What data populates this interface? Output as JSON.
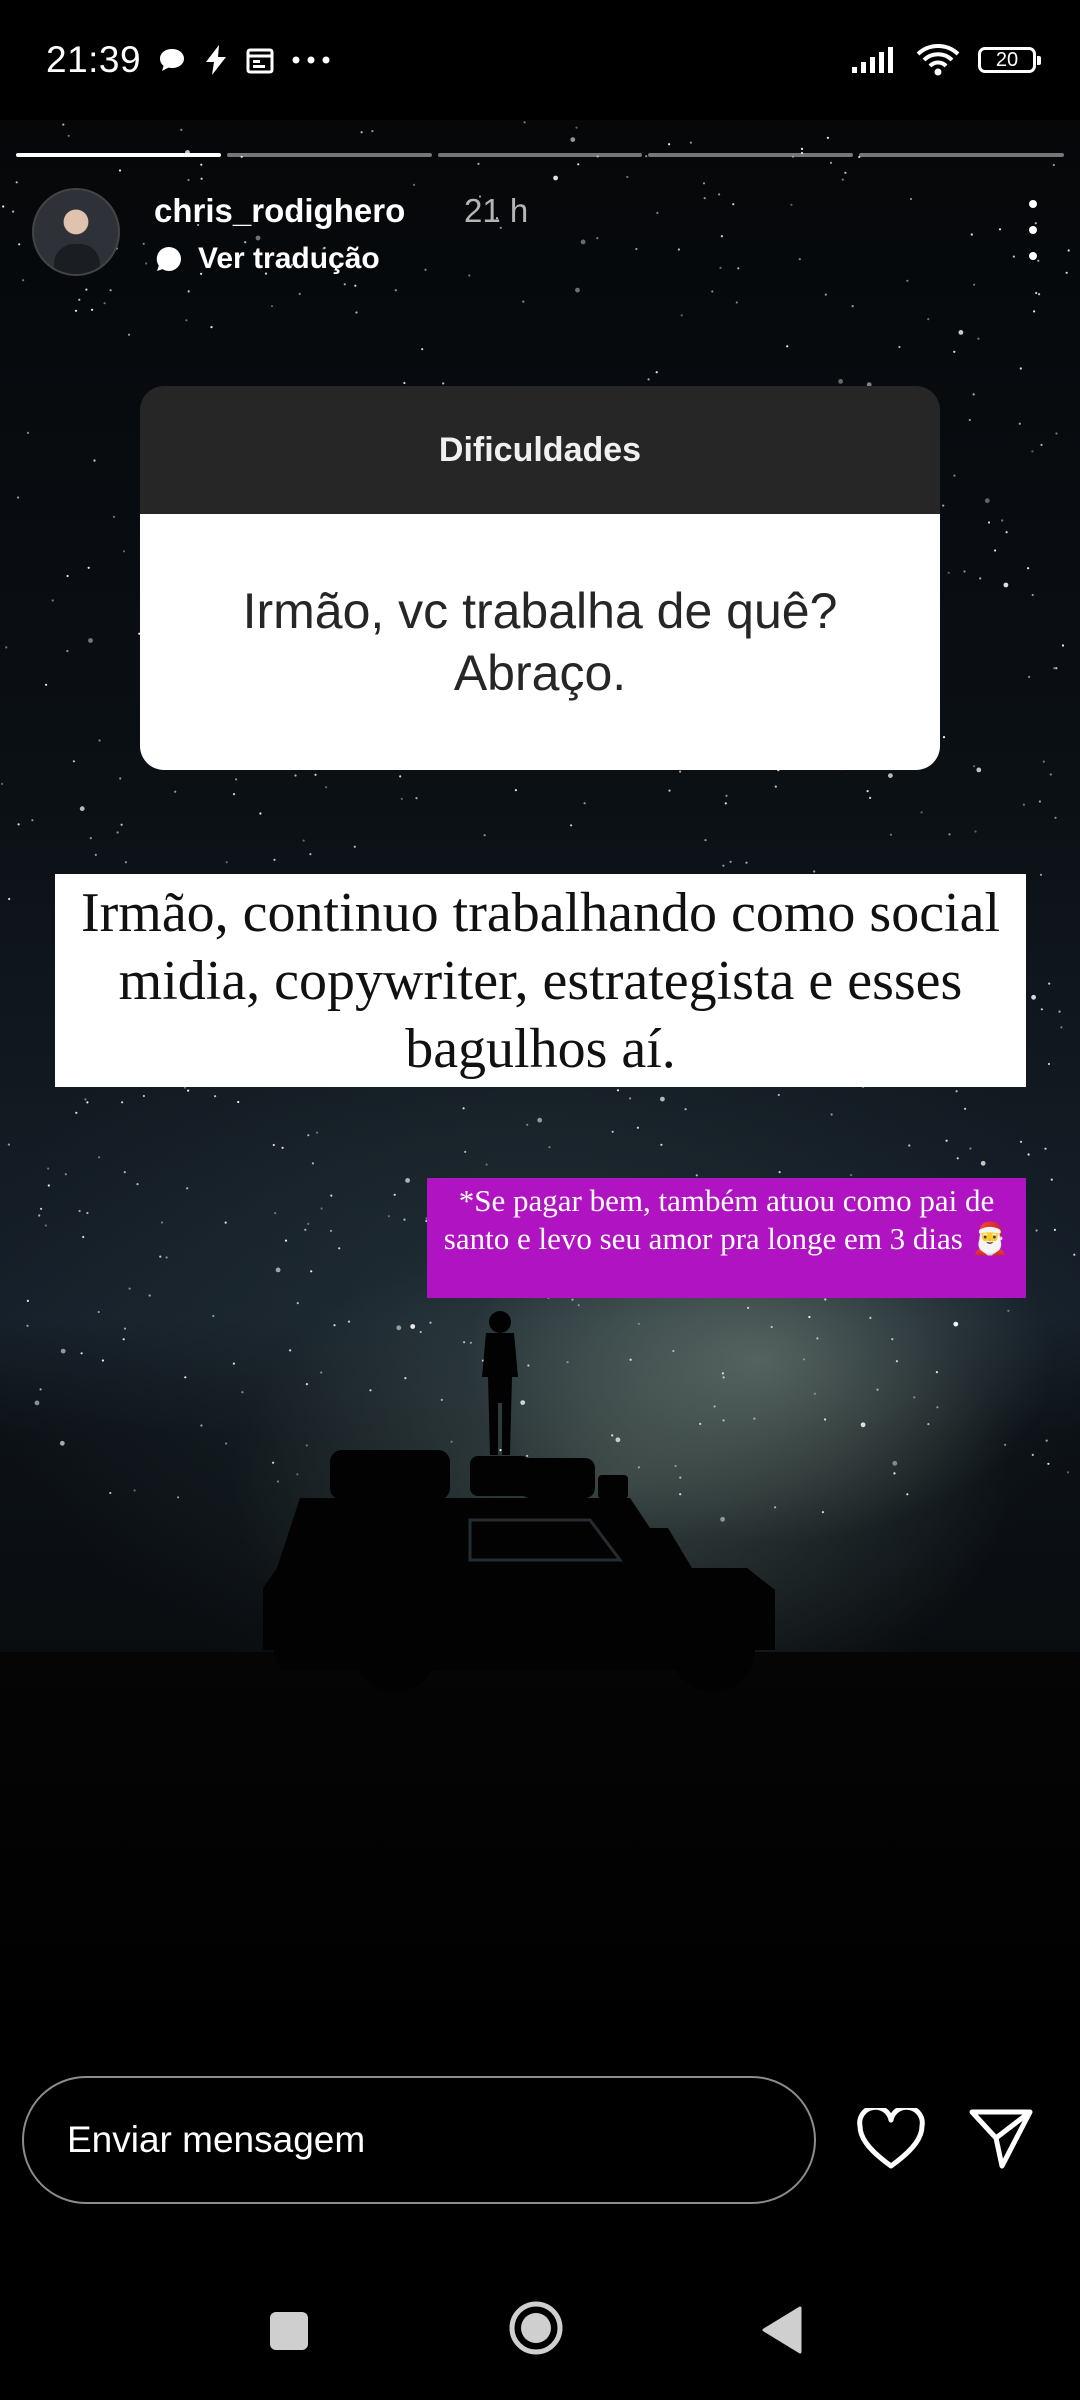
{
  "status_bar": {
    "time": "21:39",
    "battery": "20"
  },
  "story": {
    "progress": [
      1.0,
      0.0,
      0.0,
      0.0,
      0.0
    ],
    "username": "chris_rodighero",
    "time_ago": "21 h",
    "translate_label": "Ver tradução",
    "question_box": {
      "title": "Dificuldades",
      "question": "Irmão, vc trabalha de quê? Abraço."
    },
    "answer_text": "Irmão, continuo trabalhando como social midia, copywriter, estrategista e esses bagulhos aí.",
    "note_text": "*Se pagar bem, também atuou como pai de santo e levo seu amor pra longe em 3 dias 🎅"
  },
  "reply_bar": {
    "placeholder": "Enviar mensagem"
  },
  "colors": {
    "note_background": "#b013c2",
    "question_header": "#262626"
  },
  "icons": [
    "chat-bubble-icon",
    "bolt-icon",
    "calendar-icon",
    "more-notifications-icon",
    "signal-icon",
    "wifi-icon",
    "battery-icon",
    "more-options-icon",
    "heart-icon",
    "send-icon",
    "nav-square-icon",
    "nav-circle-icon",
    "nav-back-icon"
  ]
}
